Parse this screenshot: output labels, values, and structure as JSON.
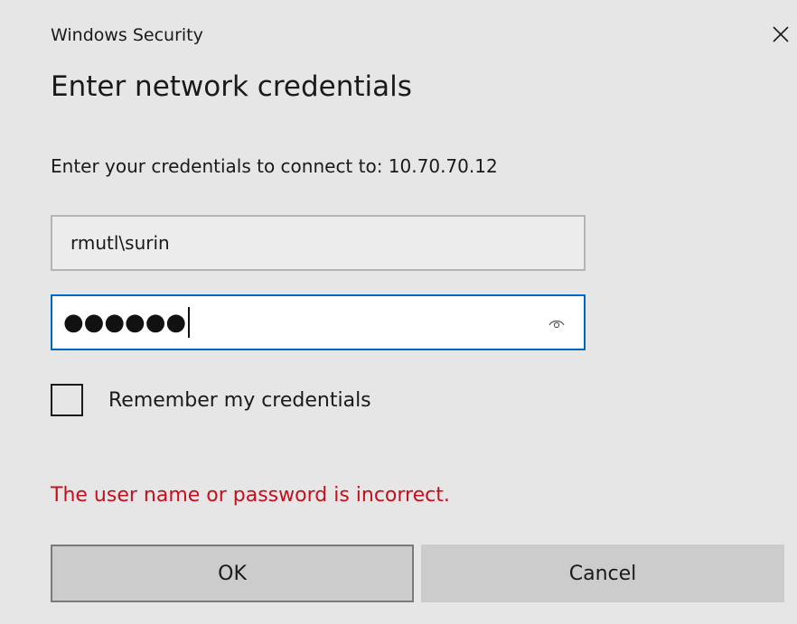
{
  "window": {
    "title": "Windows Security"
  },
  "dialog": {
    "heading": "Enter network credentials",
    "prompt": "Enter your credentials to connect to: 10.70.70.12"
  },
  "fields": {
    "username_value": "rmutl\\surin",
    "password_mask": "●●●●●●",
    "password_length": 6
  },
  "remember": {
    "label": "Remember my credentials",
    "checked": false
  },
  "error": {
    "message": "The user name or password is incorrect."
  },
  "buttons": {
    "ok_label": "OK",
    "cancel_label": "Cancel"
  },
  "icons": {
    "close": "close-icon",
    "reveal_password": "eye-icon"
  },
  "colors": {
    "background": "#e6e6e6",
    "focus_border": "#0067c0",
    "error_text": "#c50f1f",
    "button_face": "#cccccc"
  }
}
